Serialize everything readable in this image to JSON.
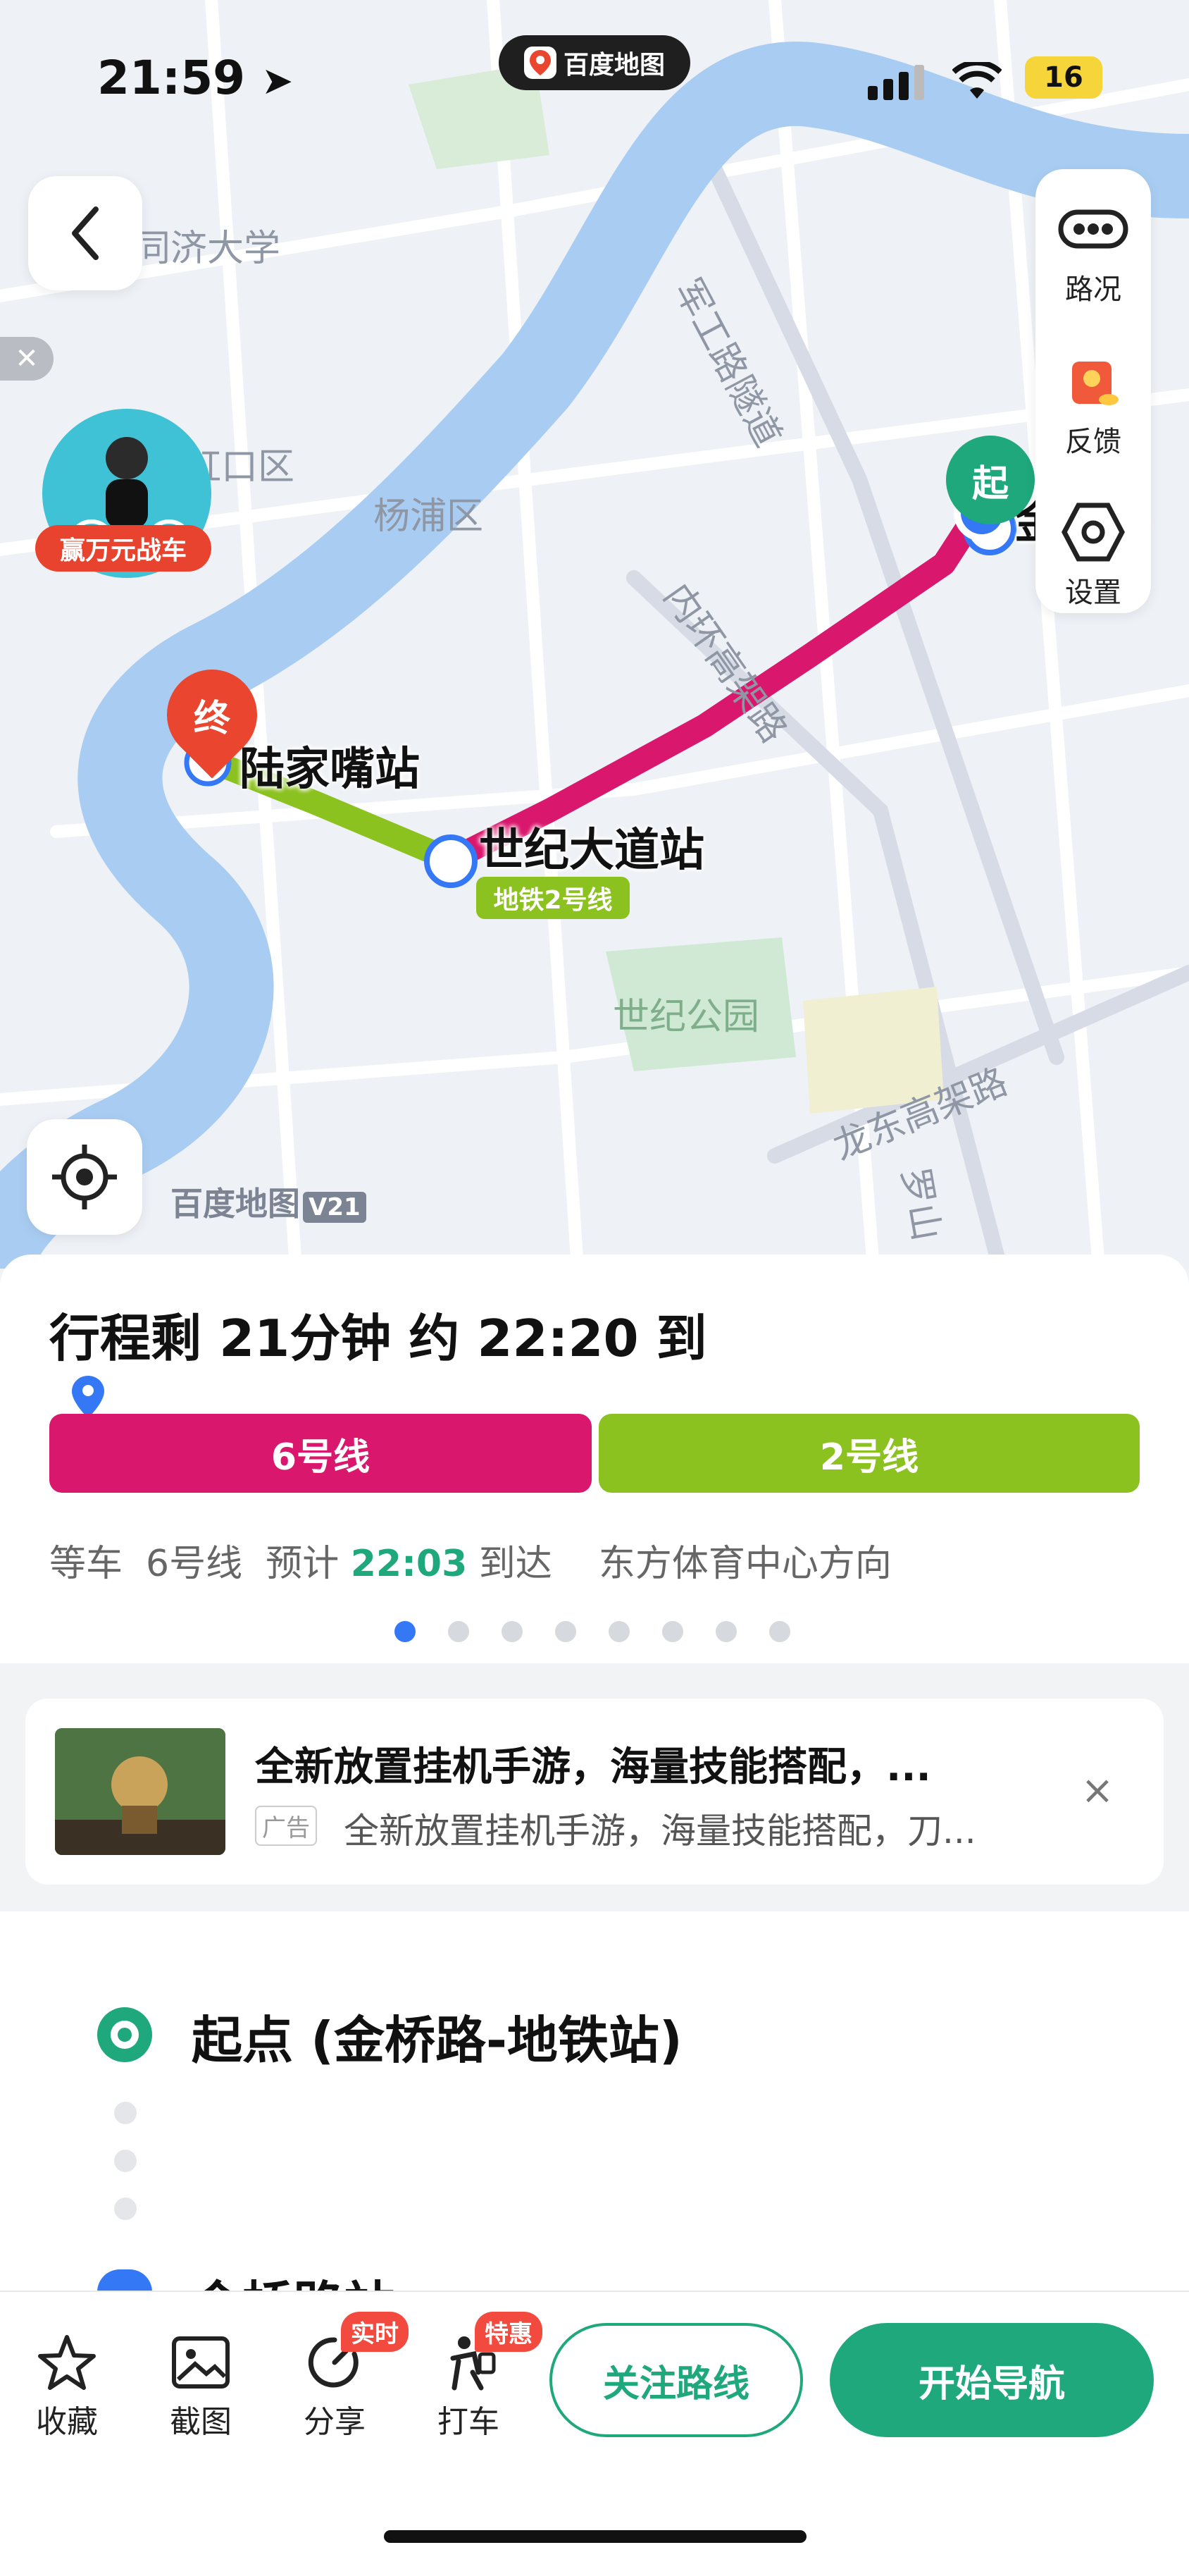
{
  "status_bar": {
    "time": "21:59",
    "app_name": "百度地图",
    "battery": "16"
  },
  "map": {
    "district_labels": [
      "同济大学",
      "虹口区",
      "杨浦区",
      "世纪公园"
    ],
    "road_labels": [
      "军工路隧道",
      "内环高架路",
      "龙东高架路",
      "罗山"
    ],
    "start_pin": "起",
    "end_pin": "终",
    "start_station_partial": "金桥路",
    "transfer_station": "世纪大道站",
    "end_station": "陆家嘴站",
    "line_badge": "地铁2号线",
    "promo_tag": "赢万元战车",
    "watermark": "百度地图",
    "watermark_version": "V21",
    "side_panel": {
      "traffic": "路况",
      "feedback": "反馈",
      "settings": "设置"
    }
  },
  "trip": {
    "title": "行程剩 21分钟 约 22:20 到",
    "segments": [
      {
        "label": "6号线",
        "color": "#d9176c"
      },
      {
        "label": "2号线",
        "color": "#8cc21f"
      }
    ],
    "wait_prefix": "等车  6号线  预计",
    "wait_time": "22:03",
    "wait_suffix": "到达    东方体育中心方向",
    "page_dots_total": 8,
    "page_dots_active": 1
  },
  "ad": {
    "title": "全新放置挂机手游，海量技能搭配，...",
    "tag": "广告",
    "subtitle": "全新放置挂机手游，海量技能搭配，刀..."
  },
  "route_detail": {
    "origin": "起点 (金桥路-地铁站)",
    "next_stop_partial": "金桥路站"
  },
  "bottom_bar": {
    "favorite": "收藏",
    "screenshot": "截图",
    "share": "分享",
    "share_badge": "实时",
    "taxi": "打车",
    "taxi_badge": "特惠",
    "follow_route": "关注路线",
    "start_nav": "开始导航"
  },
  "colors": {
    "accent_green": "#1fa87b",
    "line6": "#d9176c",
    "line2": "#8cc21f",
    "active_dot": "#3478f6"
  }
}
